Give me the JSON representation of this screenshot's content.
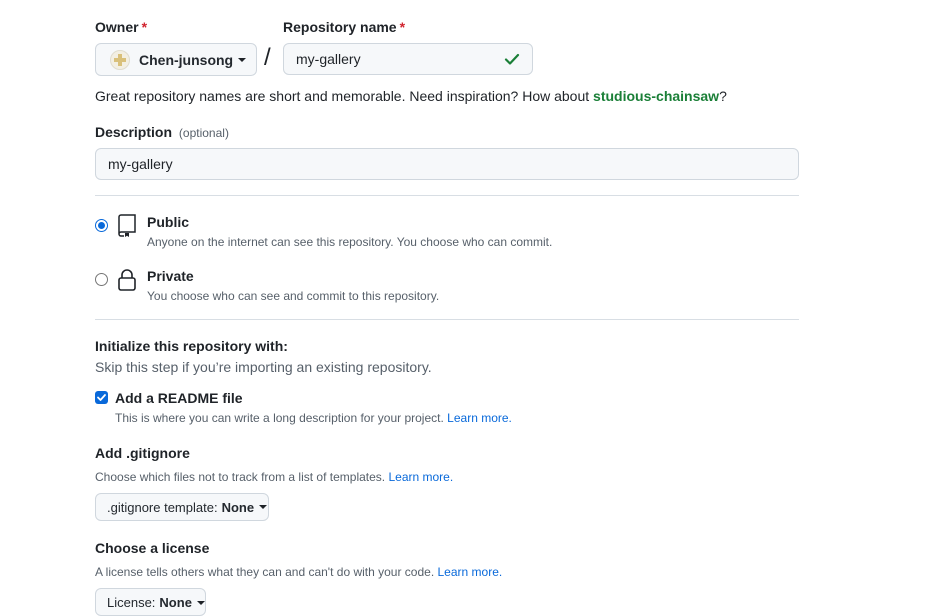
{
  "owner": {
    "label": "Owner",
    "required_mark": "*",
    "selected": "Chen-junsong"
  },
  "separator": "/",
  "repo_name": {
    "label": "Repository name",
    "required_mark": "*",
    "value": "my-gallery",
    "status": "valid"
  },
  "suggestion": {
    "text": "Great repository names are short and memorable. Need inspiration? How about ",
    "name": "studious-chainsaw",
    "suffix": "?"
  },
  "description": {
    "label": "Description",
    "optional": "(optional)",
    "value": "my-gallery"
  },
  "visibility": {
    "public": {
      "title": "Public",
      "desc": "Anyone on the internet can see this repository. You choose who can commit.",
      "checked": true
    },
    "private": {
      "title": "Private",
      "desc": "You choose who can see and commit to this repository.",
      "checked": false
    }
  },
  "init": {
    "title": "Initialize this repository with:",
    "subtitle": "Skip this step if you’re importing an existing repository.",
    "readme": {
      "label": "Add a README file",
      "desc": "This is where you can write a long description for your project.",
      "link": "Learn more.",
      "checked": true
    }
  },
  "gitignore": {
    "title": "Add .gitignore",
    "desc": "Choose which files not to track from a list of templates.",
    "link": "Learn more.",
    "button_prefix": ".gitignore template:",
    "button_value": "None"
  },
  "license": {
    "title": "Choose a license",
    "desc": "A license tells others what they can and can't do with your code.",
    "link": "Learn more.",
    "button_prefix": "License:",
    "button_value": "None"
  },
  "colors": {
    "accent": "#0969da",
    "success": "#1a7f37",
    "required": "#d1242f",
    "suggestion": "#1a7f37"
  }
}
